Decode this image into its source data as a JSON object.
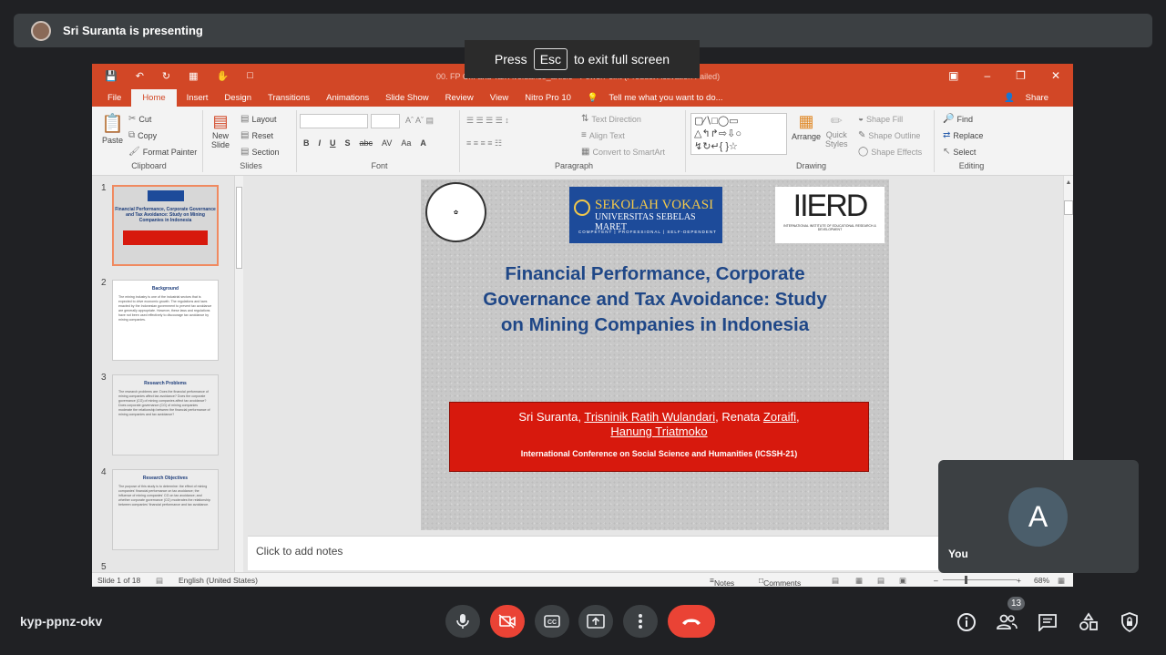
{
  "meet": {
    "presenter_text": "Sri Suranta is presenting",
    "esc_prefix": "Press",
    "esc_key": "Esc",
    "esc_suffix": "to exit full screen",
    "meeting_code": "kyp-ppnz-okv",
    "participants_count": "13",
    "self_name": "You",
    "self_initial": "A"
  },
  "ppt": {
    "title_bar": "00. FP C... and Tax Avoidance_article - PowerPoint (Product Activation Failed)",
    "tabs": [
      "File",
      "Home",
      "Insert",
      "Design",
      "Transitions",
      "Animations",
      "Slide Show",
      "Review",
      "View",
      "Nitro Pro 10"
    ],
    "active_tab": "Home",
    "tell_me": "Tell me what you want to do...",
    "share": "Share",
    "ribbon": {
      "clipboard": {
        "label": "Clipboard",
        "paste": "Paste",
        "cut": "Cut",
        "copy": "Copy",
        "format_painter": "Format Painter"
      },
      "slides": {
        "label": "Slides",
        "new_slide": "New",
        "new_slide2": "Slide",
        "layout": "Layout",
        "reset": "Reset",
        "section": "Section"
      },
      "font": {
        "label": "Font"
      },
      "paragraph": {
        "label": "Paragraph",
        "text_direction": "Text Direction",
        "align_text": "Align Text",
        "smartart": "Convert to SmartArt"
      },
      "drawing": {
        "label": "Drawing",
        "arrange": "Arrange",
        "quick_styles": "Quick",
        "quick_styles2": "Styles",
        "shape_fill": "Shape Fill",
        "shape_outline": "Shape Outline",
        "shape_effects": "Shape Effects"
      },
      "editing": {
        "label": "Editing",
        "find": "Find",
        "replace": "Replace",
        "select": "Select"
      }
    },
    "thumbnails": [
      {
        "num": "1",
        "title": "Financial Performance, Corporate Governance and Tax Avoidance: Study on Mining Companies in Indonesia",
        "body": ""
      },
      {
        "num": "2",
        "title": "Background",
        "body": "The mining industry is one of the industrial sectors that is expected to drive economic growth. The regulations and laws enacted by the Indonesian government to prevent tax avoidance are generally appropriate. However, these laws and regulations have not been used effectively to discourage tax avoidance by mining companies."
      },
      {
        "num": "3",
        "title": "Research Problems",
        "body": "The research problems are: Does the financial performance of mining companies affect tax avoidance? Does the corporate governance (CG) of mining companies affect tax avoidance? Does corporate governance (CG) of mining companies moderate the relationship between the financial performance of mining companies and tax avoidance?"
      },
      {
        "num": "4",
        "title": "Research Objectives",
        "body": "The purpose of this study is to determine: the effect of mining companies' financial performance on tax avoidance; the influence of mining companies' CG on tax avoidance; and whether corporate governance (CG) moderates the relationship between companies' financial performance and tax avoidance."
      },
      {
        "num": "5",
        "title": "",
        "body": ""
      }
    ],
    "slide": {
      "logo_univ": "SEKOLAH VOKASI",
      "logo_univ_sub": "UNIVERSITAS SEBELAS MARET",
      "logo_univ_tag": "COMPETENT | PROFESSIONAL | SELF-DEPENDENT",
      "logo_iierd": "IIERD",
      "logo_iierd_sub": "INTERNATIONAL INSTITUTE OF EDUCATIONAL RESEARCH & DEVELOPMENT",
      "title_line1": "Financial Performance, Corporate",
      "title_line2": "Governance and Tax Avoidance: Study",
      "title_line3": "on Mining Companies in Indonesia",
      "author_a": "Sri Suranta, ",
      "author_b": "Trisninik Ratih Wulandari",
      "author_c": ", Renata ",
      "author_d": "Zoraifi",
      "author_e": ",",
      "author_f": "Hanung Triatmoko",
      "conference": "International Conference on Social Science and Humanities (ICSSH-21)"
    },
    "notes_placeholder": "Click to add notes",
    "status": {
      "slide_of": "Slide 1 of 18",
      "language": "English (United States)",
      "notes": "Notes",
      "comments": "Comments",
      "zoom": "68%"
    }
  }
}
